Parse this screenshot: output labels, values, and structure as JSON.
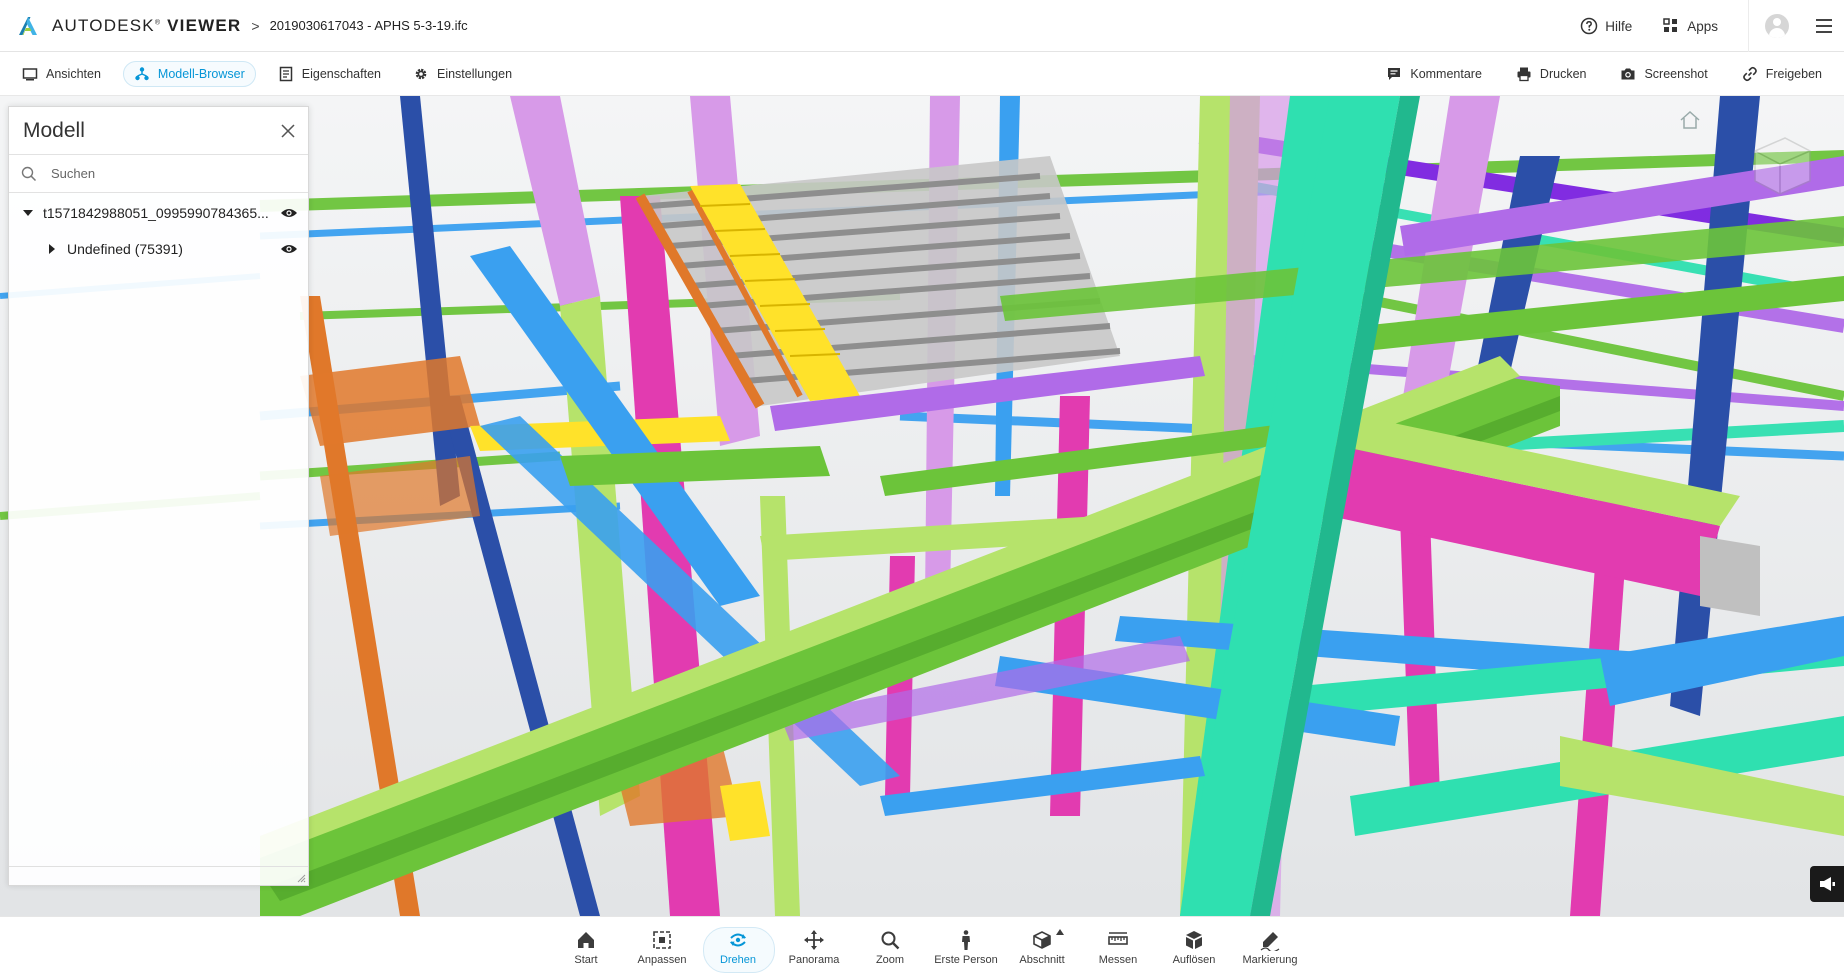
{
  "header": {
    "brand_light": "AUTODESK",
    "brand_bold": "VIEWER",
    "breadcrumb_separator": ">",
    "file_name": "2019030617043 - APHS 5-3-19.ifc",
    "help_label": "Hilfe",
    "apps_label": "Apps"
  },
  "toolbar": {
    "left": [
      {
        "label": "Ansichten",
        "icon": "views-icon"
      },
      {
        "label": "Modell-Browser",
        "icon": "model-browser-icon",
        "active": true
      },
      {
        "label": "Eigenschaften",
        "icon": "properties-icon"
      },
      {
        "label": "Einstellungen",
        "icon": "settings-gear-icon"
      }
    ],
    "right": [
      {
        "label": "Kommentare",
        "icon": "comment-icon"
      },
      {
        "label": "Drucken",
        "icon": "print-icon"
      },
      {
        "label": "Screenshot",
        "icon": "camera-icon"
      },
      {
        "label": "Freigeben",
        "icon": "link-icon"
      }
    ]
  },
  "panel": {
    "title": "Modell",
    "search_placeholder": "Suchen",
    "tree": [
      {
        "label": "t1571842988051_0995990784365...",
        "expanded": true,
        "visible": true
      },
      {
        "label": "Undefined (75391)",
        "expanded": false,
        "visible": true
      }
    ]
  },
  "bottom_tools": [
    {
      "label": "Start",
      "icon": "home-icon"
    },
    {
      "label": "Anpassen",
      "icon": "fit-to-view-icon"
    },
    {
      "label": "Drehen",
      "icon": "orbit-icon",
      "active": true
    },
    {
      "label": "Panorama",
      "icon": "pan-icon"
    },
    {
      "label": "Zoom",
      "icon": "zoom-icon"
    },
    {
      "label": "Erste Person",
      "icon": "first-person-icon"
    },
    {
      "label": "Abschnitt",
      "icon": "section-box-icon"
    },
    {
      "label": "Messen",
      "icon": "measure-ruler-icon"
    },
    {
      "label": "Auflösen",
      "icon": "explode-icon"
    },
    {
      "label": "Markierung",
      "icon": "markup-pen-icon"
    }
  ],
  "colors": {
    "accent": "#0696d7",
    "beam_green": "#6cc43a",
    "beam_lightgreen": "#b6e36b",
    "beam_teal": "#2fe0b0",
    "beam_blue": "#3aa0f0",
    "beam_navy": "#2b4fa8",
    "beam_lilac": "#d79ae8",
    "beam_magenta": "#e23bb0",
    "beam_orange": "#e0782a",
    "beam_yellow": "#ffe22a",
    "beam_purple": "#7b22e0"
  }
}
